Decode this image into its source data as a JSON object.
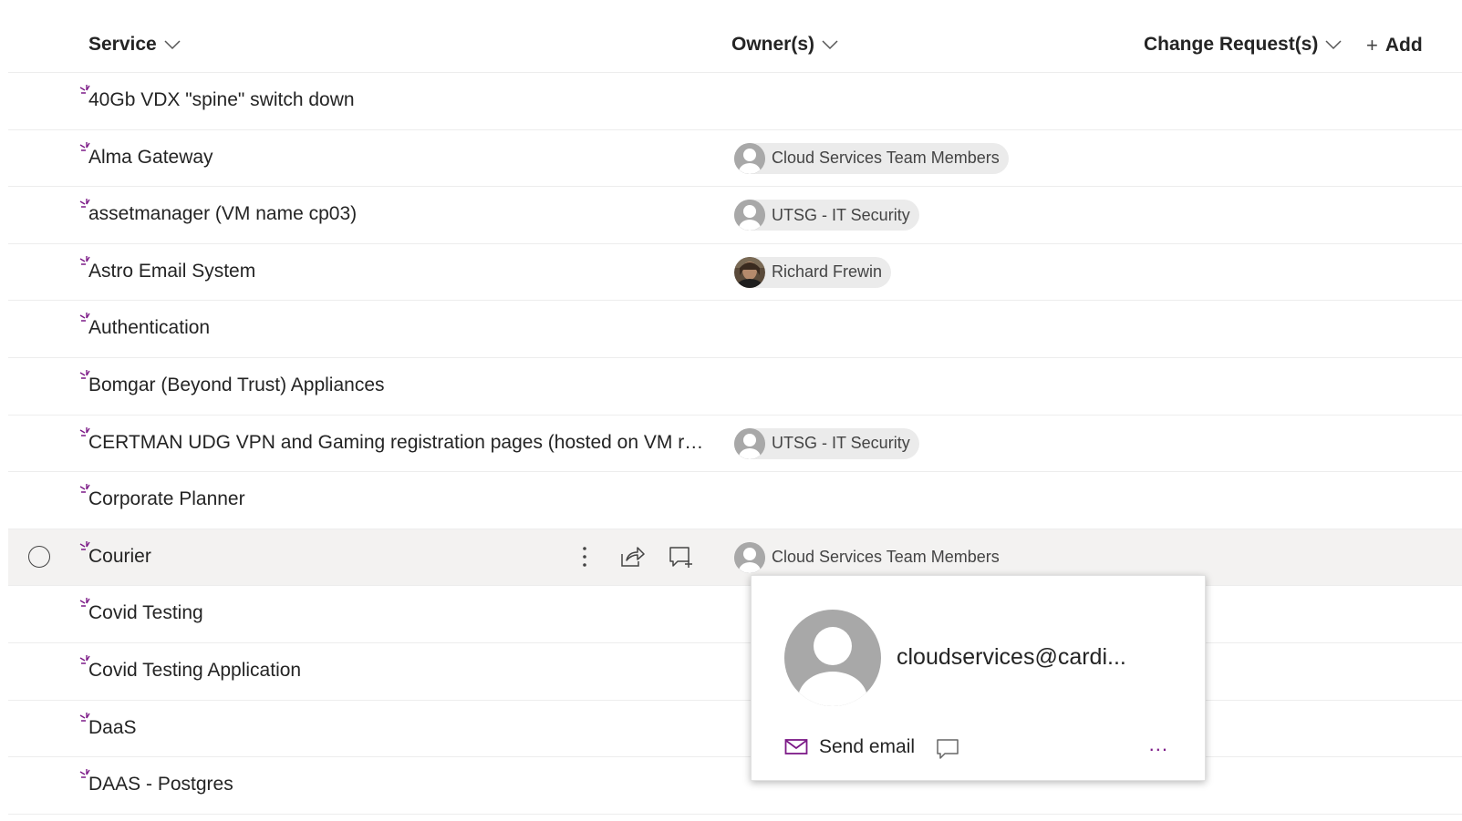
{
  "header": {
    "service_label": "Service",
    "owners_label": "Owner(s)",
    "change_request_label": "Change Request(s)",
    "add_label": "Add"
  },
  "rows": [
    {
      "title": "40Gb VDX \"spine\" switch down",
      "owner": null
    },
    {
      "title": "Alma Gateway",
      "owner": "Cloud Services Team Members"
    },
    {
      "title": "assetmanager (VM name cp03)",
      "owner": "UTSG - IT Security"
    },
    {
      "title": "Astro Email System",
      "owner": "Richard Frewin"
    },
    {
      "title": "Authentication",
      "owner": null
    },
    {
      "title": "Bomgar (Beyond Trust) Appliances",
      "owner": null
    },
    {
      "title": "CERTMAN UDG VPN and Gaming registration pages (hosted on VM resla...",
      "owner": "UTSG - IT Security"
    },
    {
      "title": "Corporate Planner",
      "owner": null
    },
    {
      "title": "Courier",
      "owner": "Cloud Services Team Members"
    },
    {
      "title": "Covid Testing",
      "owner": null
    },
    {
      "title": "Covid Testing Application",
      "owner": null
    },
    {
      "title": "DaaS",
      "owner": null
    },
    {
      "title": "DAAS - Postgres",
      "owner": null
    }
  ],
  "card": {
    "email": "cloudservices@cardi...",
    "send_email_label": "Send email",
    "more_label": "..."
  },
  "colors": {
    "accent": "#7c1a87",
    "selected_row": "#f3f2f1",
    "pill": "#ebebeb"
  },
  "icons": {
    "new_item": "new-item-sparkle-icon",
    "sort": "chevron-down-icon",
    "row_more": "vertical-ellipsis-icon",
    "share": "share-icon",
    "comment": "add-comment-icon",
    "mail": "mail-icon",
    "chat": "chat-icon",
    "person": "person-icon"
  }
}
